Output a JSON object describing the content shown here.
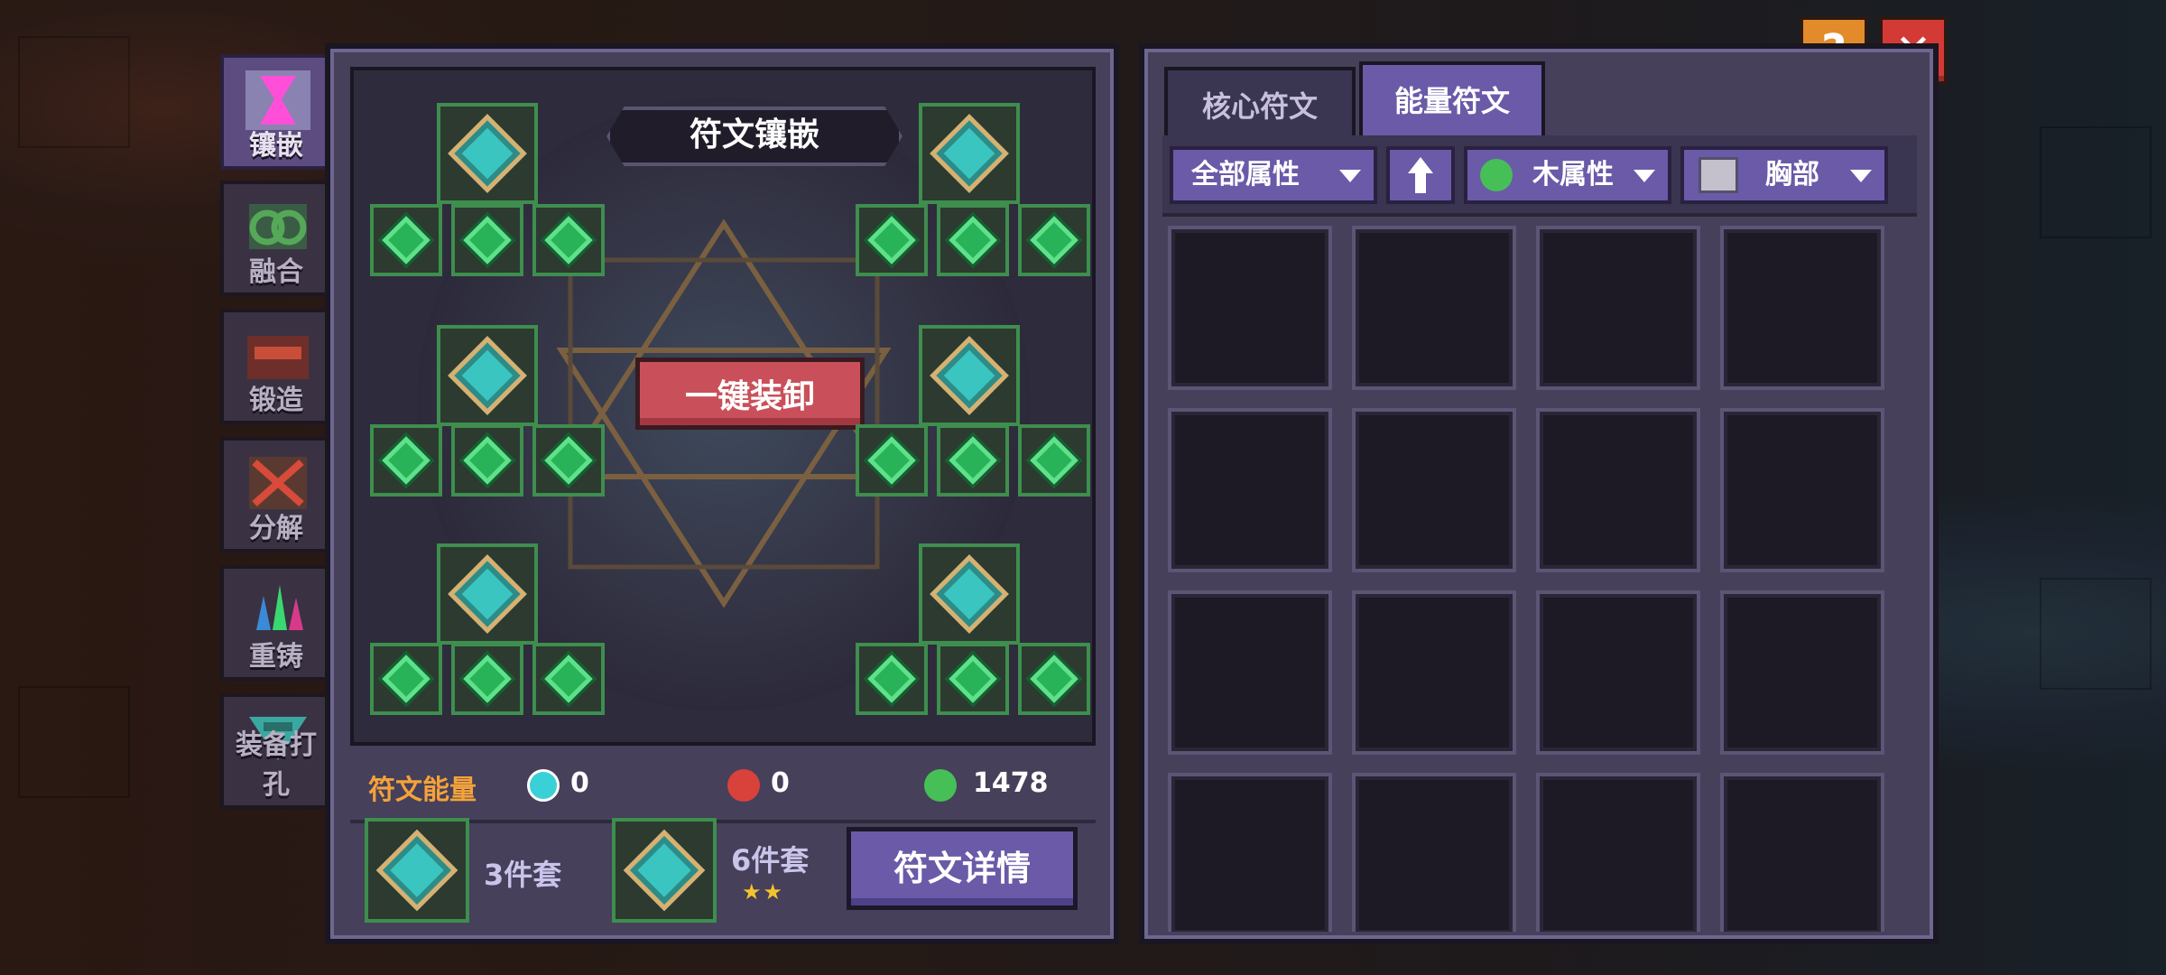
{
  "header": {
    "help_label": "?",
    "close_label": "✕"
  },
  "side_tabs": [
    {
      "label": "镶嵌",
      "icon": "hourglass-icon",
      "active": true
    },
    {
      "label": "融合",
      "icon": "links-icon",
      "active": false
    },
    {
      "label": "锻造",
      "icon": "anvil-chest-icon",
      "active": false
    },
    {
      "label": "分解",
      "icon": "decompose-icon",
      "active": false
    },
    {
      "label": "重铸",
      "icon": "crystals-icon",
      "active": false
    },
    {
      "label": "装备打孔",
      "icon": "drill-icon",
      "active": false
    }
  ],
  "left": {
    "title": "符文镶嵌",
    "unequip_all": "一键装卸",
    "energy_label": "符文能量",
    "energy": [
      {
        "icon": "cyan-gem-icon",
        "value": "0",
        "color": "#3ad0d8"
      },
      {
        "icon": "red-fire-icon",
        "value": "0",
        "color": "#d8423a"
      },
      {
        "icon": "green-leaf-icon",
        "value": "1478",
        "color": "#46c056"
      }
    ],
    "set3_label": "3件套",
    "set6_label": "6件套",
    "set6_stars": "★★",
    "details_button": "符文详情"
  },
  "right": {
    "tabs": [
      {
        "label": "核心符文",
        "active": false
      },
      {
        "label": "能量符文",
        "active": true
      }
    ],
    "filters": {
      "attribute_all": "全部属性",
      "sort_icon": "up-arrow-icon",
      "element": "木属性",
      "element_icon": "green-leaf-icon",
      "slot": "胸部",
      "slot_icon": "chest-armor-icon"
    },
    "empty_cells": 16
  },
  "colors": {
    "accent": "#6a5aa8",
    "energy_label": "#f4a23a",
    "slot_border": "#3e8e4e",
    "unequip": "#c9505a"
  }
}
